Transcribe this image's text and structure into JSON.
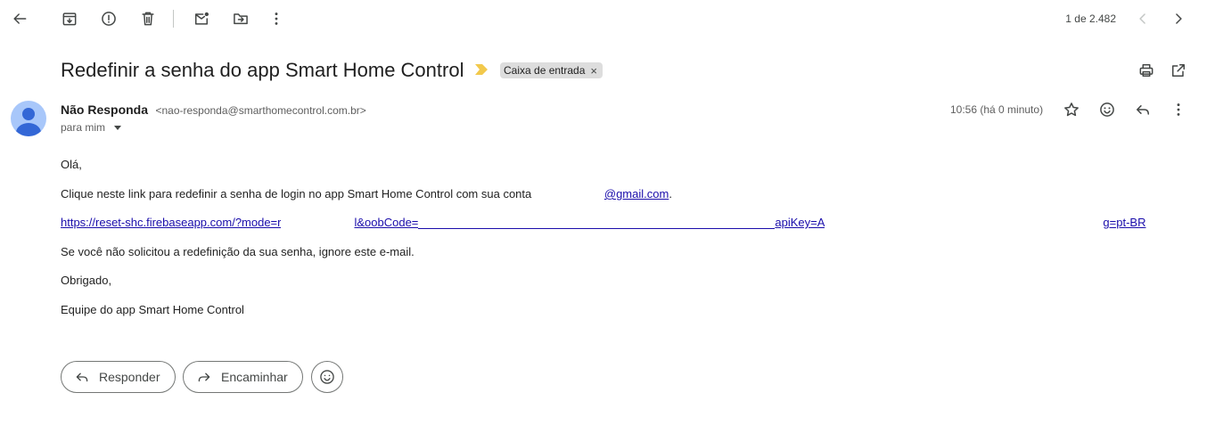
{
  "toolbar": {
    "icons": [
      "back-arrow-icon",
      "archive-icon",
      "report-spam-icon",
      "delete-icon",
      "mark-unread-icon",
      "move-to-icon",
      "more-vert-icon"
    ],
    "pager": "1 de 2.482"
  },
  "email": {
    "subject": "Redefinir a senha do app Smart Home Control",
    "label": "Caixa de entrada",
    "sender_name": "Não Responda",
    "sender_email": "<nao-responda@smarthomecontrol.com.br>",
    "to": "para mim",
    "time": "10:56 (há 0 minuto)",
    "body": {
      "greeting": "Olá,",
      "line1_prefix": "Clique neste link para redefinir a senha de login no app Smart Home Control com sua conta",
      "line1_email_visible": "@gmail.com",
      "line1_suffix": ".",
      "link_part1": "https://reset-shc.firebaseapp.com/?mode=r",
      "link_part2": "l&oobCode=",
      "link_part3": "apiKey=A",
      "link_part4": "g=pt-BR",
      "ignore": "Se você não solicitou a redefinição da sua senha, ignore este e-mail.",
      "thanks": "Obrigado,",
      "signature": "Equipe do app Smart Home Control"
    }
  },
  "actions": {
    "reply": "Responder",
    "forward": "Encaminhar"
  },
  "colors": {
    "link": "#1a0dab",
    "avatar_bg": "#a8c7fa",
    "avatar_fg": "#3367d6",
    "importance": "#f2c94c",
    "chip_bg": "#dddddd"
  }
}
